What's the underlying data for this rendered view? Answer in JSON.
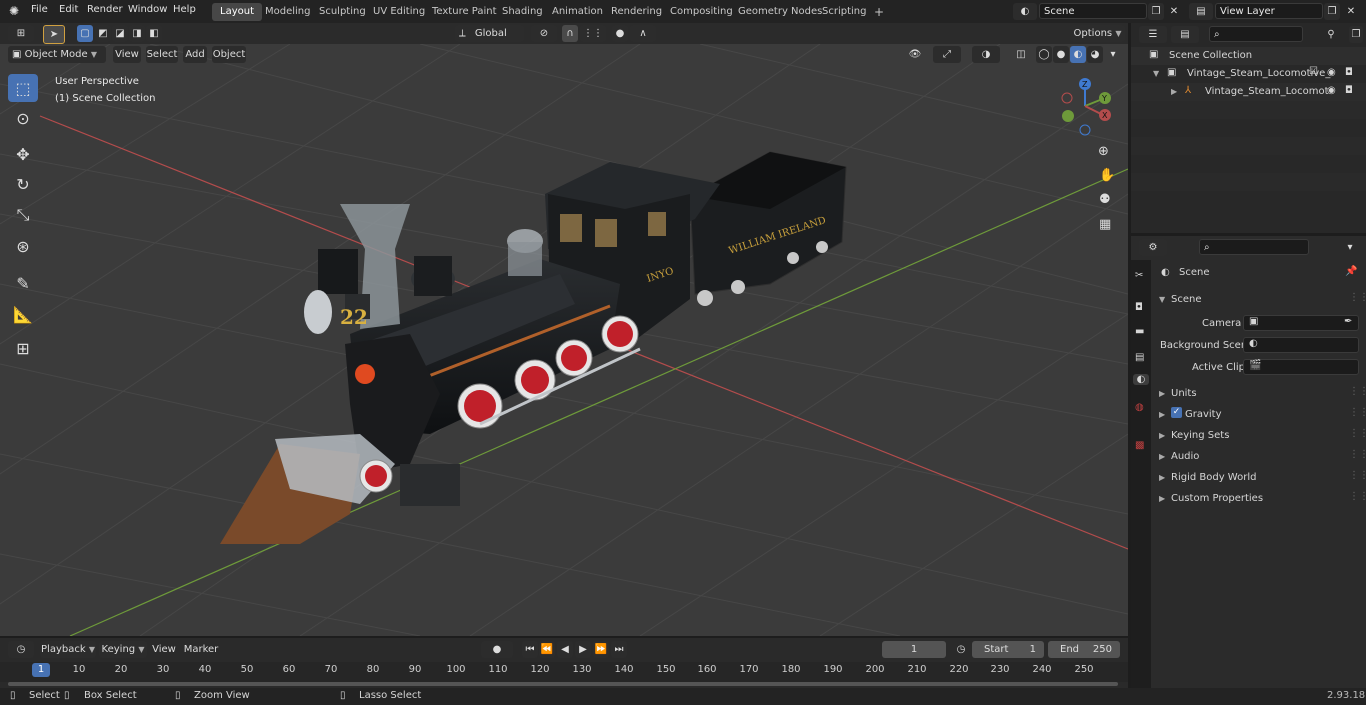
{
  "topbar": {
    "menu": [
      "File",
      "Edit",
      "Render",
      "Window",
      "Help"
    ],
    "workspaces": [
      "Layout",
      "Modeling",
      "Sculpting",
      "UV Editing",
      "Texture Paint",
      "Shading",
      "Animation",
      "Rendering",
      "Compositing",
      "Geometry Nodes",
      "Scripting"
    ],
    "active_workspace": "Layout",
    "add_tab": "+",
    "scene_name": "Scene",
    "view_layer": "View Layer"
  },
  "tool_header": {
    "transform_orientation": "Global",
    "options_label": "Options"
  },
  "viewport_header": {
    "mode": "Object Mode",
    "menus": [
      "View",
      "Select",
      "Add",
      "Object"
    ]
  },
  "viewport": {
    "perspective_label": "User Perspective",
    "collection_label": "(1) Scene Collection",
    "gizmo": {
      "z": "Z",
      "y": "Y",
      "x": "X"
    },
    "model_plate_number": "22",
    "cab_lettering": "INYO",
    "tender_lettering": "WILLIAM IRELAND"
  },
  "outliner": {
    "root": "Scene Collection",
    "items": [
      {
        "label": "Vintage_Steam_Locomotive_",
        "depth": 1
      },
      {
        "label": "Vintage_Steam_Locomot",
        "depth": 2
      }
    ]
  },
  "properties": {
    "context": "Scene",
    "panel_title": "Scene",
    "fields": [
      {
        "label": "Camera",
        "value": ""
      },
      {
        "label": "Background Scene",
        "value": ""
      },
      {
        "label": "Active Clip",
        "value": ""
      }
    ],
    "collapsed_panels": [
      "Units",
      "Gravity",
      "Keying Sets",
      "Audio",
      "Rigid Body World",
      "Custom Properties"
    ],
    "gravity_checked": true
  },
  "timeline": {
    "menus": [
      "Playback",
      "Keying",
      "View",
      "Marker"
    ],
    "current_frame": "1",
    "start_label": "Start",
    "start_value": "1",
    "end_label": "End",
    "end_value": "250",
    "ticks": [
      "1",
      "10",
      "20",
      "30",
      "40",
      "50",
      "60",
      "70",
      "80",
      "90",
      "100",
      "110",
      "120",
      "130",
      "140",
      "150",
      "160",
      "170",
      "180",
      "190",
      "200",
      "210",
      "220",
      "230",
      "240",
      "250"
    ]
  },
  "statusbar": {
    "select": "Select",
    "box_select": "Box Select",
    "zoom_view": "Zoom View",
    "lasso_select": "Lasso Select",
    "version": "2.93.18"
  },
  "colors": {
    "accent": "#4772b3",
    "active_frame": "#4772b3",
    "x_axis": "#b34c4c",
    "y_axis": "#6e9a3a",
    "z_axis": "#3f7ad1"
  }
}
